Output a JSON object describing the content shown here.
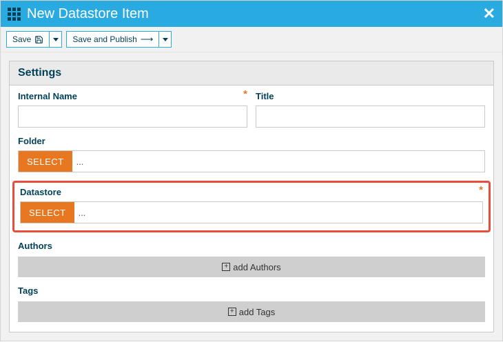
{
  "header": {
    "title": "New Datastore Item"
  },
  "toolbar": {
    "save_label": "Save",
    "save_publish_label": "Save and Publish"
  },
  "panel": {
    "title": "Settings",
    "internal_name": {
      "label": "Internal Name",
      "value": ""
    },
    "title_field": {
      "label": "Title",
      "value": ""
    },
    "folder": {
      "label": "Folder",
      "select_label": "SELECT",
      "value": "..."
    },
    "datastore": {
      "label": "Datastore",
      "select_label": "SELECT",
      "value": "..."
    },
    "authors": {
      "label": "Authors",
      "add_label": "add Authors"
    },
    "tags": {
      "label": "Tags",
      "add_label": "add Tags"
    }
  }
}
